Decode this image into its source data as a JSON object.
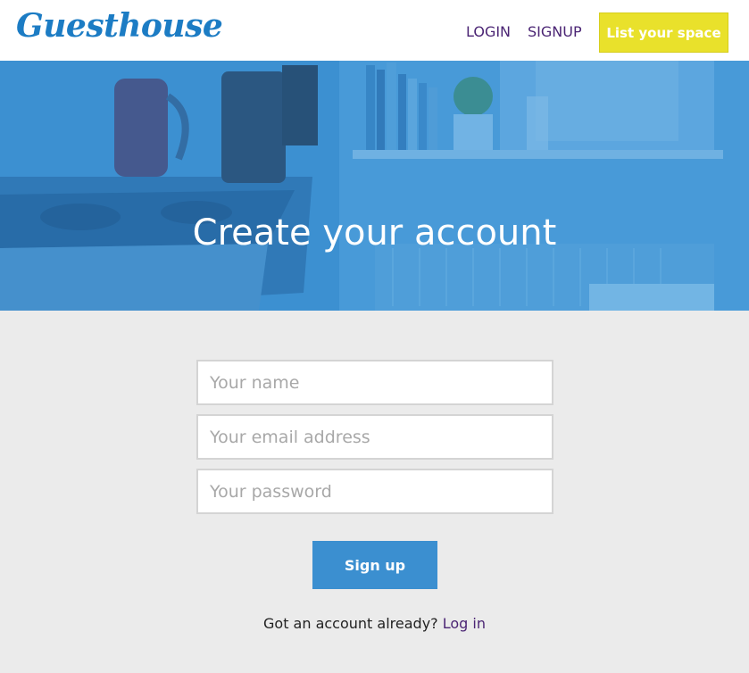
{
  "header": {
    "logo": "Guesthouse",
    "login_label": "LOGIN",
    "signup_label": "SIGNUP",
    "list_space_label": "List your space"
  },
  "hero": {
    "title": "Create your account"
  },
  "form": {
    "name_placeholder": "Your name",
    "email_placeholder": "Your email address",
    "password_placeholder": "Your password",
    "submit_label": "Sign up"
  },
  "footer": {
    "prompt": "Got an account already?",
    "login_link": "Log in"
  },
  "colors": {
    "brand": "#1c7cc4",
    "nav_link": "#4b2574",
    "list_space_bg": "#e9e12b",
    "hero_overlay": "#3b8fd0",
    "button": "#3b8fd0",
    "page_bg": "#ebebeb"
  }
}
